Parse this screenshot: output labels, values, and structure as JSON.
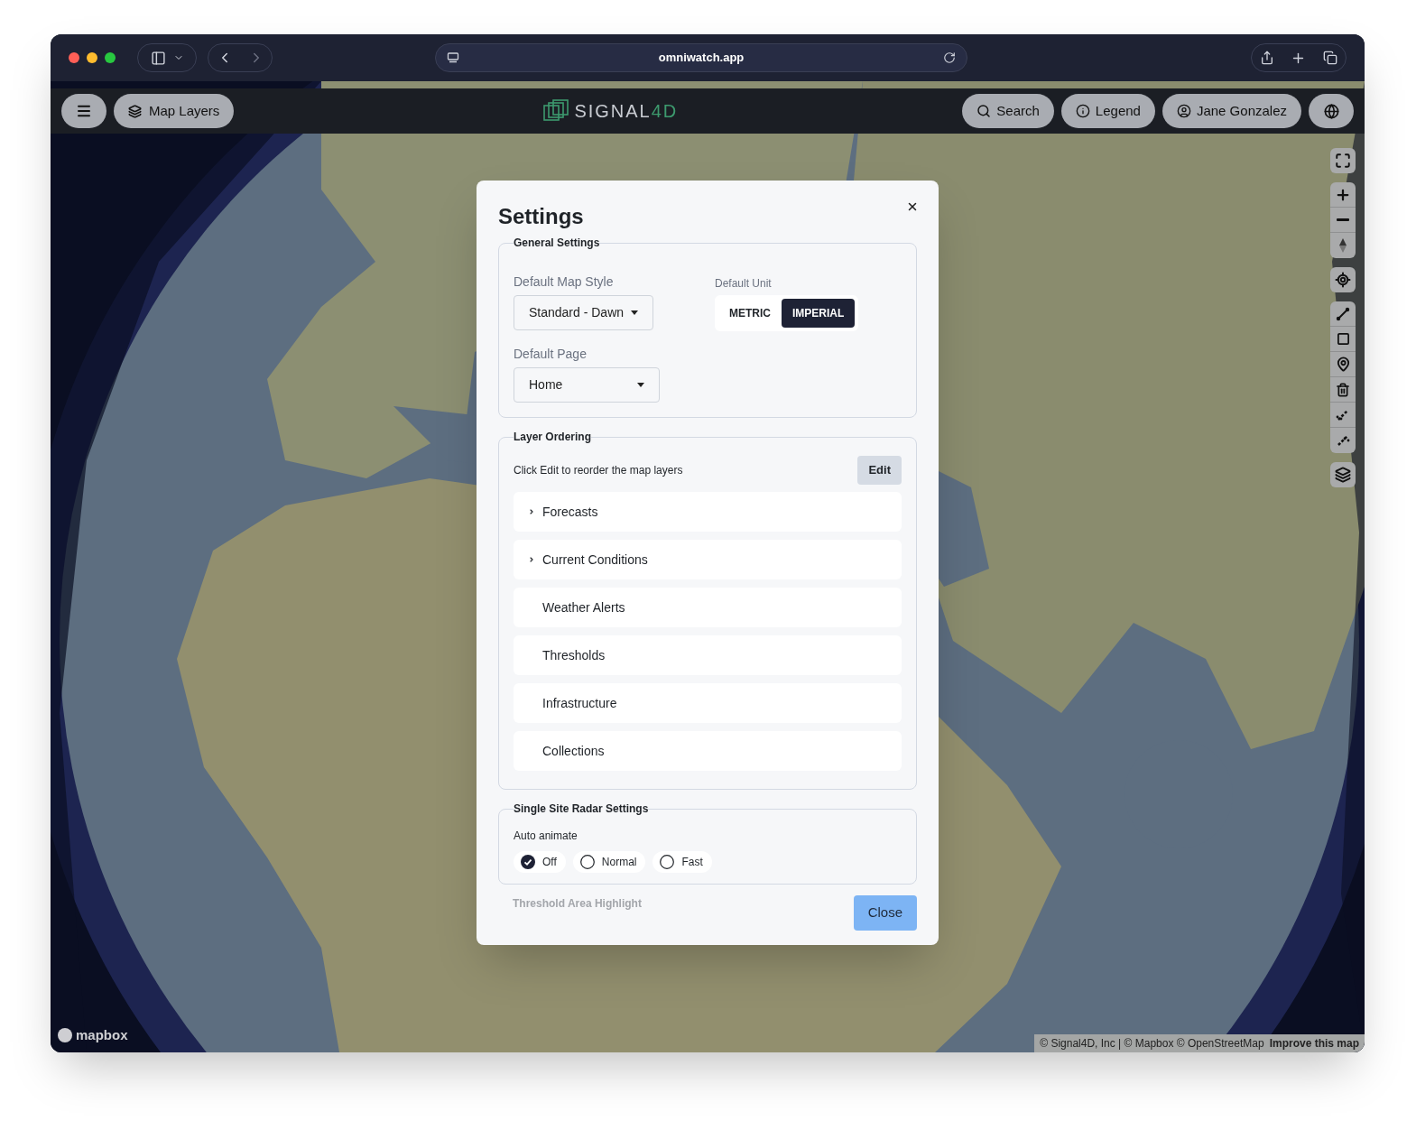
{
  "browser": {
    "url": "omniwatch.app"
  },
  "header": {
    "map_layers": "Map Layers",
    "logo": {
      "text": "SIGNAL",
      "accent": "4D"
    },
    "buttons": [
      {
        "kind": "search",
        "label": "Search"
      },
      {
        "kind": "info",
        "label": "Legend"
      },
      {
        "kind": "user",
        "label": "Jane Gonzalez"
      }
    ]
  },
  "settings": {
    "title": "Settings",
    "general": {
      "legend": "General Settings",
      "map_style": {
        "label": "Default Map Style",
        "value": "Standard - Dawn"
      },
      "unit": {
        "label": "Default Unit",
        "options": [
          {
            "label": "METRIC",
            "selected": false
          },
          {
            "label": "IMPERIAL",
            "selected": true
          }
        ]
      },
      "default_page": {
        "label": "Default Page",
        "value": "Home"
      }
    },
    "layer_ordering": {
      "legend": "Layer Ordering",
      "hint": "Click Edit to reorder the map layers",
      "edit_button": "Edit",
      "layers": [
        {
          "label": "Forecasts",
          "expandable": true
        },
        {
          "label": "Current Conditions",
          "expandable": true
        },
        {
          "label": "Weather Alerts",
          "expandable": false
        },
        {
          "label": "Thresholds",
          "expandable": false
        },
        {
          "label": "Infrastructure",
          "expandable": false
        },
        {
          "label": "Collections",
          "expandable": false
        }
      ]
    },
    "radar": {
      "legend": "Single Site Radar Settings",
      "auto_animate": {
        "label": "Auto animate",
        "options": [
          {
            "label": "Off",
            "selected": true
          },
          {
            "label": "Normal",
            "selected": false
          },
          {
            "label": "Fast",
            "selected": false
          }
        ]
      }
    },
    "next_legend": "Threshold Area Highlight",
    "close_button": "Close"
  },
  "attribution": {
    "logo": "mapbox",
    "text": "© Signal4D, Inc | © Mapbox © OpenStreetMap",
    "link": "Improve this map"
  }
}
